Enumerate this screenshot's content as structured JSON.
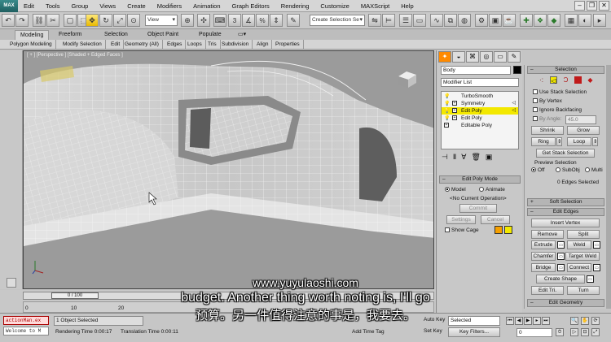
{
  "menu": {
    "logo": "MAX",
    "items": [
      "Edit",
      "Tools",
      "Group",
      "Views",
      "Create",
      "Modifiers",
      "Animation",
      "Graph Editors",
      "Rendering",
      "Customize",
      "MAXScript",
      "Help"
    ]
  },
  "toolbar": {
    "view_dropdown": "View",
    "selection_set": "Create Selection Se",
    "number_3": "3",
    "percent": "%"
  },
  "ribbon": {
    "tabs": [
      "Modeling",
      "Freeform",
      "Selection",
      "Object Paint",
      "Populate"
    ],
    "sub_items": [
      "Polygon Modeling",
      "Modify Selection",
      "Edit",
      "Geometry (All)",
      "Edges",
      "Loops",
      "Tris",
      "Subdivision",
      "Align",
      "Properties"
    ]
  },
  "viewport": {
    "label": "[ + ] [Perspective ] [Shaded + Edged Faces ]"
  },
  "command_panel": {
    "object_name": "Body",
    "modifier_list": "Modifier List",
    "stack": [
      {
        "label": "TurboSmooth",
        "selected": false,
        "expand": false
      },
      {
        "label": "Symmetry",
        "selected": false,
        "expand": true
      },
      {
        "label": "Edit Poly",
        "selected": true,
        "expand": true
      },
      {
        "label": "Edit Poly",
        "selected": false,
        "expand": true
      },
      {
        "label": "Editable Poly",
        "selected": false,
        "expand": true
      }
    ],
    "edit_poly_mode": {
      "title": "Edit Poly Mode",
      "model": "Model",
      "animate": "Animate",
      "current_op": "<No Current Operation>",
      "commit": "Commit",
      "settings": "Settings",
      "cancel": "Cancel",
      "show_cage": "Show Cage",
      "cage_color_1": "#f5a000",
      "cage_color_2": "#f3e800"
    }
  },
  "right_panel": {
    "selection_title": "Selection",
    "use_stack": "Use Stack Selection",
    "by_vertex": "By Vertex",
    "ignore_backfacing": "Ignore Backfacing",
    "by_angle": "By Angle:",
    "angle_value": "45.0",
    "shrink": "Shrink",
    "grow": "Grow",
    "ring": "Ring",
    "loop": "Loop",
    "get_stack": "Get Stack Selection",
    "preview_title": "Preview Selection",
    "preview_off": "Off",
    "preview_subobj": "SubObj",
    "preview_multi": "Multi",
    "edges_selected": "0 Edges Selected",
    "soft_selection": "Soft Selection",
    "edit_edges": "Edit Edges",
    "insert_vertex": "Insert Vertex",
    "remove": "Remove",
    "split": "Split",
    "extrude": "Extrude",
    "weld": "Weld",
    "chamfer": "Chamfer",
    "target_weld": "Target Weld",
    "bridge": "Bridge",
    "connect": "Connect",
    "create_shape": "Create Shape",
    "edit_tri": "Edit Tri.",
    "turn": "Turn",
    "edit_geometry": "Edit Geometry"
  },
  "timeline": {
    "slider_label": "0 / 100",
    "ticks": [
      "0",
      "10",
      "20"
    ]
  },
  "status": {
    "maxscript_1": "actionMan.ex",
    "maxscript_2": "Welcome to M",
    "objects_selected": "1 Object Selected",
    "render_time": "Rendering Time  0:00:17",
    "translation_time": "Translation Time  0:00:11",
    "add_time_tag": "Add Time Tag",
    "auto_key": "Auto Key",
    "selected": "Selected",
    "set_key": "Set Key",
    "key_filters": "Key Filters...",
    "frame": "0"
  },
  "subtitles": {
    "url": "www.yuyulaoshi.com",
    "english": "budget. Another thing worth noting is, I'll go",
    "chinese": "预算。另一件值得注意的事是，我要去。"
  }
}
